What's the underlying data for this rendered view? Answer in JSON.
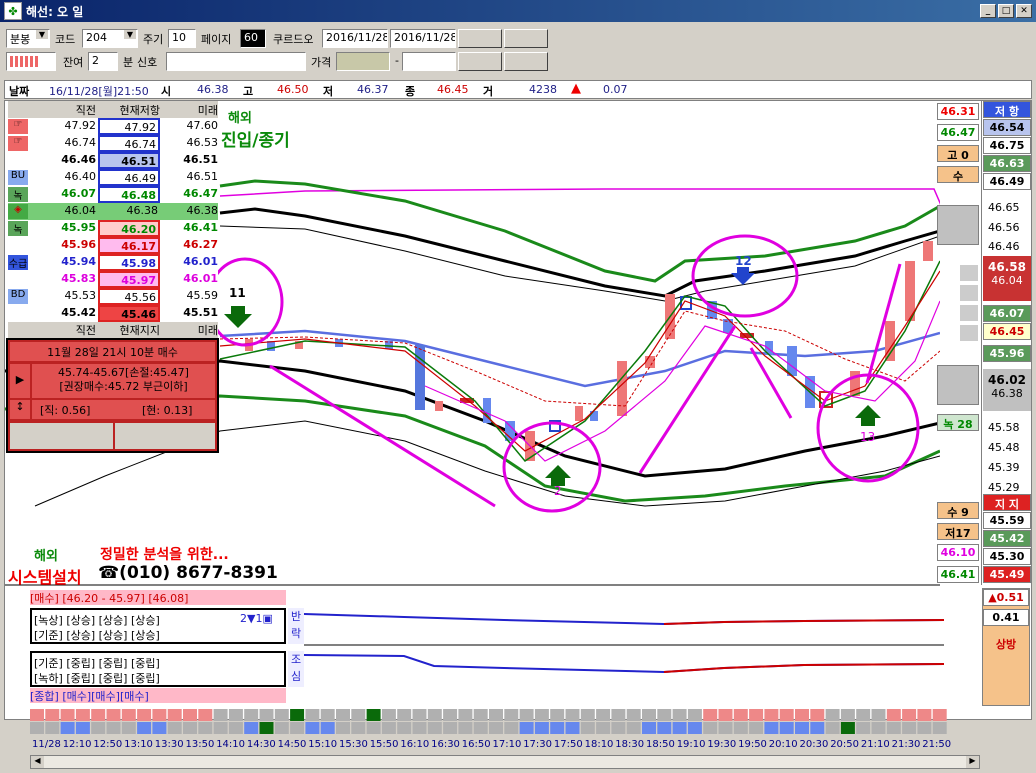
{
  "window": {
    "title": "해선: 오     일"
  },
  "toolbar": {
    "period_type": "분봉",
    "code_label": "코드",
    "code_value": "204",
    "cycle_label": "주기",
    "cycle_value": "10",
    "page_label": "페이지",
    "page_value": "60",
    "crude_label": "쿠르드오",
    "date_from": "2016/11/28",
    "date_to": "2016/11/28",
    "remain_label": "잔여",
    "remain_value": "2",
    "min_label": "분",
    "signal_label": "신호",
    "price_label": "가격",
    "dash": "-"
  },
  "infobar": {
    "date_label": "날짜",
    "datetime": "16/11/28[월]21:50",
    "open_label": "시",
    "open": "46.38",
    "high_label": "고",
    "high": "46.50",
    "low_label": "저",
    "low": "46.37",
    "close_label": "종",
    "close": "46.45",
    "vol_label": "거",
    "volume": "4238",
    "change": "0.07"
  },
  "quote": {
    "headers": [
      "직전",
      "현재저항",
      "미래"
    ],
    "rows": [
      {
        "tag": "☞",
        "a": "47.92",
        "b": "47.92",
        "c": "47.60"
      },
      {
        "tag": "☞",
        "a": "46.74",
        "b": "46.74",
        "c": "46.53"
      },
      {
        "tag": "",
        "a": "46.46",
        "b": "46.51",
        "c": "46.51"
      },
      {
        "tag": "BU",
        "a": "46.40",
        "b": "46.49",
        "c": "46.51"
      },
      {
        "tag": "녹",
        "a": "46.07",
        "b": "46.48",
        "c": "46.47"
      },
      {
        "tag": "◈",
        "a": "46.04",
        "b": "46.38",
        "c": "46.38"
      },
      {
        "tag": "녹",
        "a": "45.95",
        "b": "46.20",
        "c": "46.41"
      },
      {
        "tag": "",
        "a": "45.96",
        "b": "46.17",
        "c": "46.27"
      },
      {
        "tag": "수급",
        "a": "45.94",
        "b": "45.98",
        "c": "46.01"
      },
      {
        "tag": "",
        "a": "45.83",
        "b": "45.97",
        "c": "46.01"
      },
      {
        "tag": "BD",
        "a": "45.53",
        "b": "45.56",
        "c": "45.59"
      },
      {
        "tag": "",
        "a": "45.42",
        "b": "45.46",
        "c": "45.51"
      }
    ],
    "footer": [
      "직전",
      "현재지지",
      "미래"
    ]
  },
  "alert": {
    "title": "11월 28일 21시 10분 매수",
    "line1": "45.74-45.67[손절:45.47]",
    "line2": "[권장매수:45.72 부근이하]",
    "line3a": "[직: 0.56]",
    "line3b": "[현: 0.13]"
  },
  "annotations": {
    "overseas": "해외",
    "entry": "진입/종기",
    "ad_overseas": "해외",
    "ad_line": "정밀한 분석을 위한...",
    "ad_system": "시스템설치",
    "ad_phone": "☎(010) 8677-8391",
    "n11": "11",
    "n12": "12",
    "n2": "2",
    "n13": "13"
  },
  "right_upper": {
    "header": "저 항",
    "vals": [
      "46.54",
      "46.75",
      "46.63",
      "46.49"
    ]
  },
  "right_labels": {
    "r1": "46.31",
    "r2": "46.47",
    "r3": "고 0",
    "r4": "수",
    "r5": "녹 28",
    "r6": "수 9",
    "r7": "저17",
    "r8": "46.10",
    "r9": "46.41"
  },
  "right_ladder": {
    "vals": [
      "46.65",
      "46.56",
      "46.46"
    ],
    "cur_a": "46.58",
    "cur_b": "46.04",
    "v1": "46.07",
    "v2": "46.45",
    "v3": "45.96",
    "big_a": "46.02",
    "big_b": "46.38"
  },
  "right_lower": {
    "vals": [
      "45.58",
      "45.48",
      "45.39",
      "45.29"
    ],
    "header": "지 지",
    "sup": [
      "45.59",
      "45.42",
      "45.30",
      "45.49"
    ]
  },
  "lower_panel": {
    "title": "[매수] [46.20 - 45.97] [46.08]",
    "r1": "[녹상] [상승] [상승] [상승]",
    "r2": "[기준] [상승] [상승] [상승]",
    "count": "2▼1▣",
    "r3": "[기준] [중립] [중립] [중립]",
    "r4": "[녹하] [중립] [중립] [중립]",
    "r5": "[종합] [매수][매수][매수]",
    "side1": "반락",
    "side2": "조심",
    "right_a": "▲0.51",
    "right_b": "0.41",
    "right_c": "상방"
  },
  "time_axis": [
    "11/28",
    "12:10",
    "12:50",
    "13:10",
    "13:30",
    "13:50",
    "14:10",
    "14:30",
    "14:50",
    "15:10",
    "15:30",
    "15:50",
    "16:10",
    "16:30",
    "16:50",
    "17:10",
    "17:30",
    "17:50",
    "18:10",
    "18:30",
    "18:50",
    "19:10",
    "19:30",
    "19:50",
    "20:10",
    "20:30",
    "20:50",
    "21:10",
    "21:30",
    "21:50"
  ],
  "colors": {
    "accent_red": "#e00000",
    "green": "#007a00",
    "magenta": "#e000e0",
    "blue": "#0000d0"
  }
}
